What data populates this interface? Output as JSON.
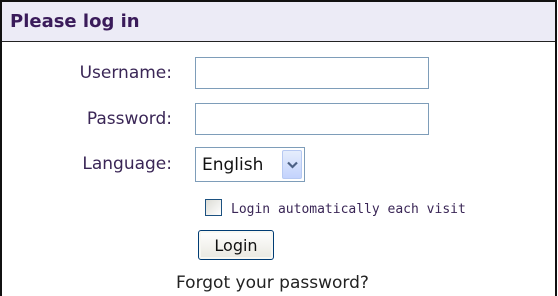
{
  "panel": {
    "title": "Please log in"
  },
  "form": {
    "username_label": "Username:",
    "username_value": "",
    "password_label": "Password:",
    "password_value": "",
    "language_label": "Language:",
    "language_selected": "English",
    "auto_login_label": "Login automatically each visit",
    "auto_login_checked": false,
    "login_button_label": "Login",
    "forgot_link_label": "Forgot your password?"
  },
  "icons": {
    "dropdown": "chevron-down-icon"
  },
  "colors": {
    "header_bg": "#ecebf6",
    "title_text": "#3a1b5a",
    "label_text": "#3a2656",
    "input_border": "#7e9db9"
  }
}
